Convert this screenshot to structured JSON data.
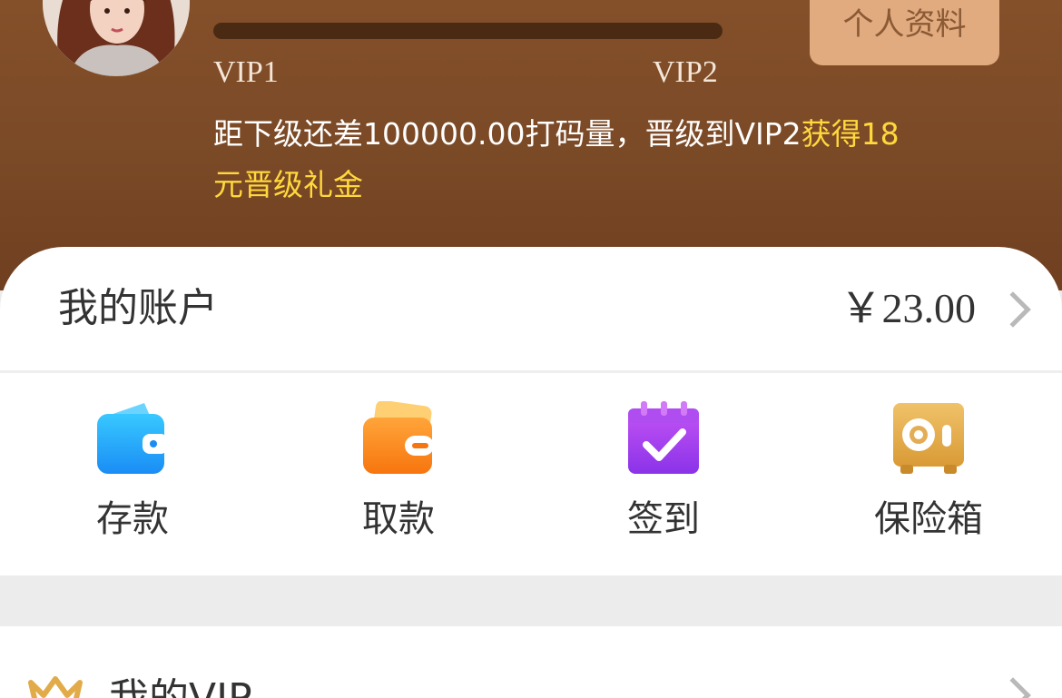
{
  "profile": {
    "progress_fraction": 0.0,
    "current_level": "VIP1",
    "next_level": "VIP2",
    "upgrade_prefix": "距下级还差100000.00打码量，晋级到VIP2",
    "upgrade_reward": "获得18元晋级礼金",
    "profile_button": "个人资料"
  },
  "account": {
    "title": "我的账户",
    "balance": "￥23.00"
  },
  "actions": [
    {
      "label": "存款",
      "icon": "wallet-icon"
    },
    {
      "label": "取款",
      "icon": "withdraw-wallet-icon"
    },
    {
      "label": "签到",
      "icon": "calendar-check-icon"
    },
    {
      "label": "保险箱",
      "icon": "safe-icon"
    }
  ],
  "vip_section": {
    "title": "我的VIP",
    "icon": "crown-icon"
  },
  "colors": {
    "hero_brown": "#7a4926",
    "highlight_yellow": "#ffd83d",
    "profile_button_bg": "#e2ab7f"
  }
}
